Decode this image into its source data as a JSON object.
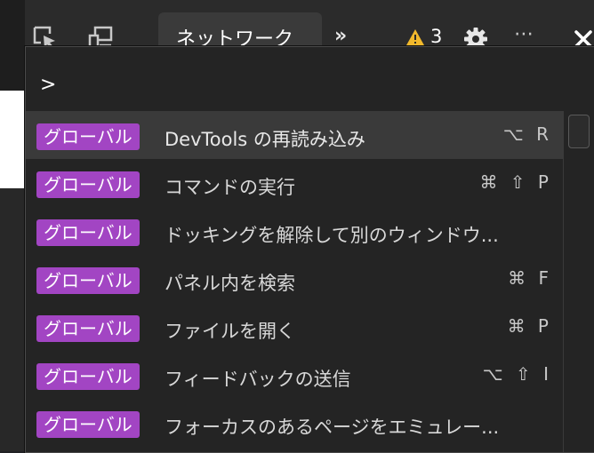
{
  "toolbar": {
    "active_tab": "ネットワーク",
    "more_tabs": "»",
    "warning_count": "3",
    "more_options": "⋯",
    "icons": [
      "element-picker-icon",
      "device-toolbar-icon",
      "warning-icon",
      "gear-icon",
      "kebab-menu-icon",
      "close-icon"
    ]
  },
  "command_palette": {
    "prompt": ">",
    "input_value": "",
    "items": [
      {
        "category": "グローバル",
        "title": "DevTools の再読み込み",
        "shortcut": "⌥ R",
        "selected": true
      },
      {
        "category": "グローバル",
        "title": "コマンドの実行",
        "shortcut": "⌘ ⇧ P",
        "selected": false
      },
      {
        "category": "グローバル",
        "title": "ドッキングを解除して別のウィンドウ...",
        "shortcut": "",
        "selected": false
      },
      {
        "category": "グローバル",
        "title": "パネル内を検索",
        "shortcut": "⌘ F",
        "selected": false
      },
      {
        "category": "グローバル",
        "title": "ファイルを開く",
        "shortcut": "⌘ P",
        "selected": false
      },
      {
        "category": "グローバル",
        "title": "フィードバックの送信",
        "shortcut": "⌥ ⇧ I",
        "selected": false
      },
      {
        "category": "グローバル",
        "title": "フォーカスのあるページをエミュレー...",
        "shortcut": "",
        "selected": false
      }
    ]
  },
  "colors": {
    "badge": "#a245c3",
    "background": "#242424",
    "selected_row": "#3a3a3a",
    "warning": "#f2b92c"
  }
}
